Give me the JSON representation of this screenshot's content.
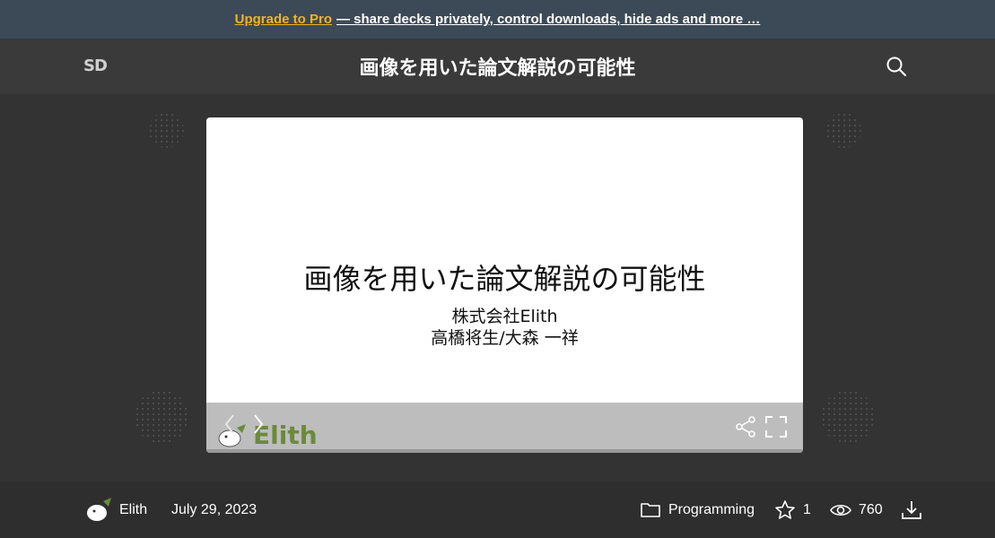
{
  "promo": {
    "link_text": "Upgrade to Pro",
    "rest_text": "— share decks privately, control downloads, hide ads and more …"
  },
  "header": {
    "logo": "SD",
    "title": "画像を用いた論文解説の可能性"
  },
  "slide": {
    "title": "画像を用いた論文解説の可能性",
    "company": "株式会社Elith",
    "authors": "高橋将生/大森 一祥",
    "brand": "Elith"
  },
  "footer": {
    "author": "Elith",
    "date": "July 29, 2023",
    "category": "Programming",
    "stars": "1",
    "views": "760"
  },
  "colors": {
    "promo_bg": "#3c4a57",
    "pro_link": "#f0b323",
    "brand_green": "#6b8a3a"
  },
  "icons": [
    "search-icon",
    "chevron-left-icon",
    "chevron-right-icon",
    "share-icon",
    "fullscreen-icon",
    "folder-icon",
    "star-icon",
    "eye-icon",
    "download-icon"
  ]
}
